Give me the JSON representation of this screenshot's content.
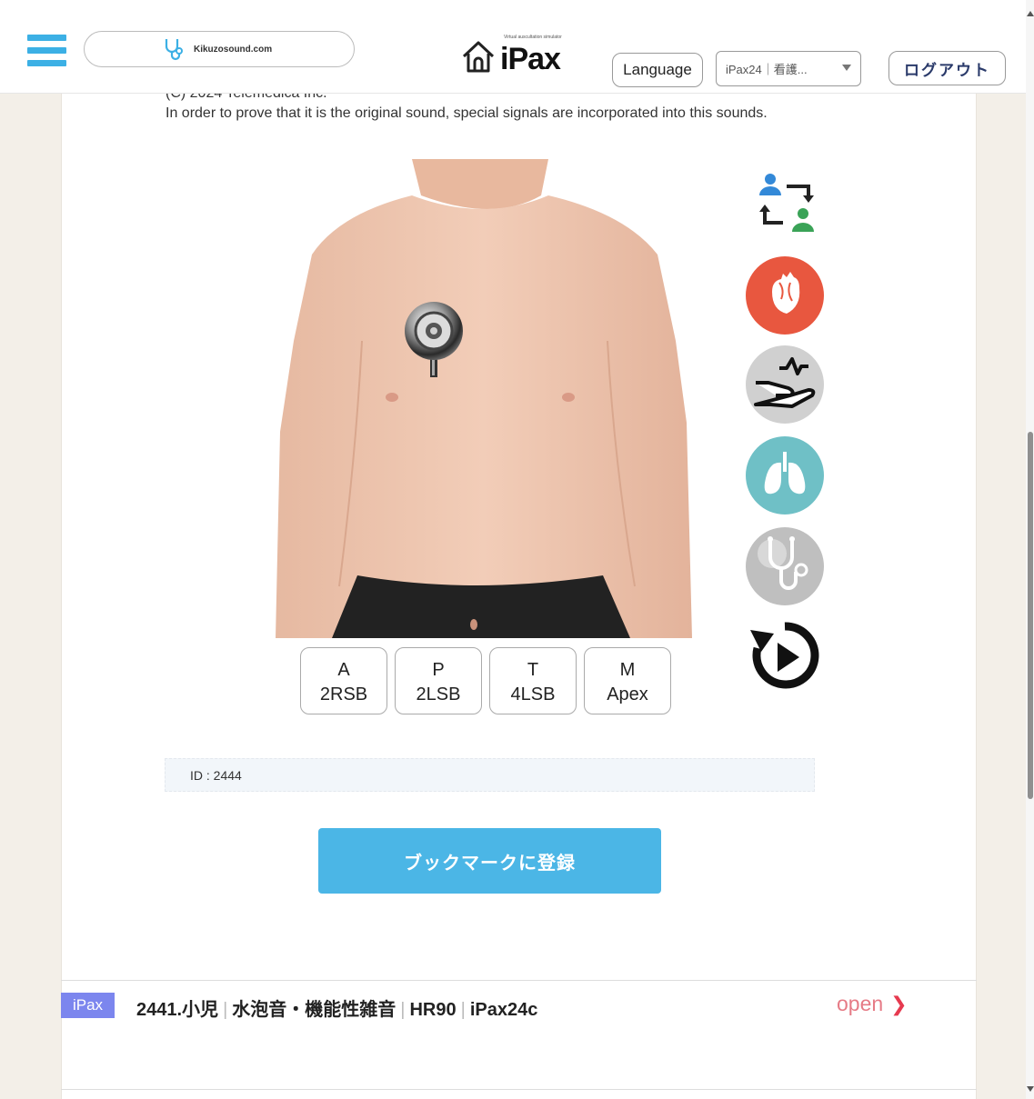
{
  "header": {
    "site_name": "Kikuzosound.com",
    "logo_tagline": "Virtual auscultation simulator",
    "logo_text": "iPax",
    "language_label": "Language",
    "select_value": "iPax24｜看護...",
    "logout_label": "ログアウト"
  },
  "copyright": {
    "line1": "(C) 2024 Telemedica Inc.",
    "line2": "In order to prove that it is the original sound, special signals are incorporated into this sounds."
  },
  "positions": [
    {
      "top": "A",
      "bottom": "2RSB"
    },
    {
      "top": "P",
      "bottom": "2LSB"
    },
    {
      "top": "T",
      "bottom": "4LSB"
    },
    {
      "top": "M",
      "bottom": "Apex"
    }
  ],
  "side_icons": [
    "swap-users-icon",
    "heart-icon",
    "pulse-hand-icon",
    "lungs-icon",
    "stethoscope-icon",
    "replay-icon"
  ],
  "record": {
    "id_text": "ID : 2444",
    "bookmark_label": "ブックマークに登録"
  },
  "list": {
    "badge": "iPax",
    "title": "2441.小児",
    "part2": "水泡音・機能性雑音",
    "part3": "HR90",
    "part4": "iPax24c",
    "open_label": "open"
  },
  "colors": {
    "accent_blue": "#4bb6e6",
    "heart_red": "#e8573f",
    "lung_teal": "#6fc0c6",
    "badge_purple": "#7c86ee",
    "open_pink": "#e67b86"
  }
}
